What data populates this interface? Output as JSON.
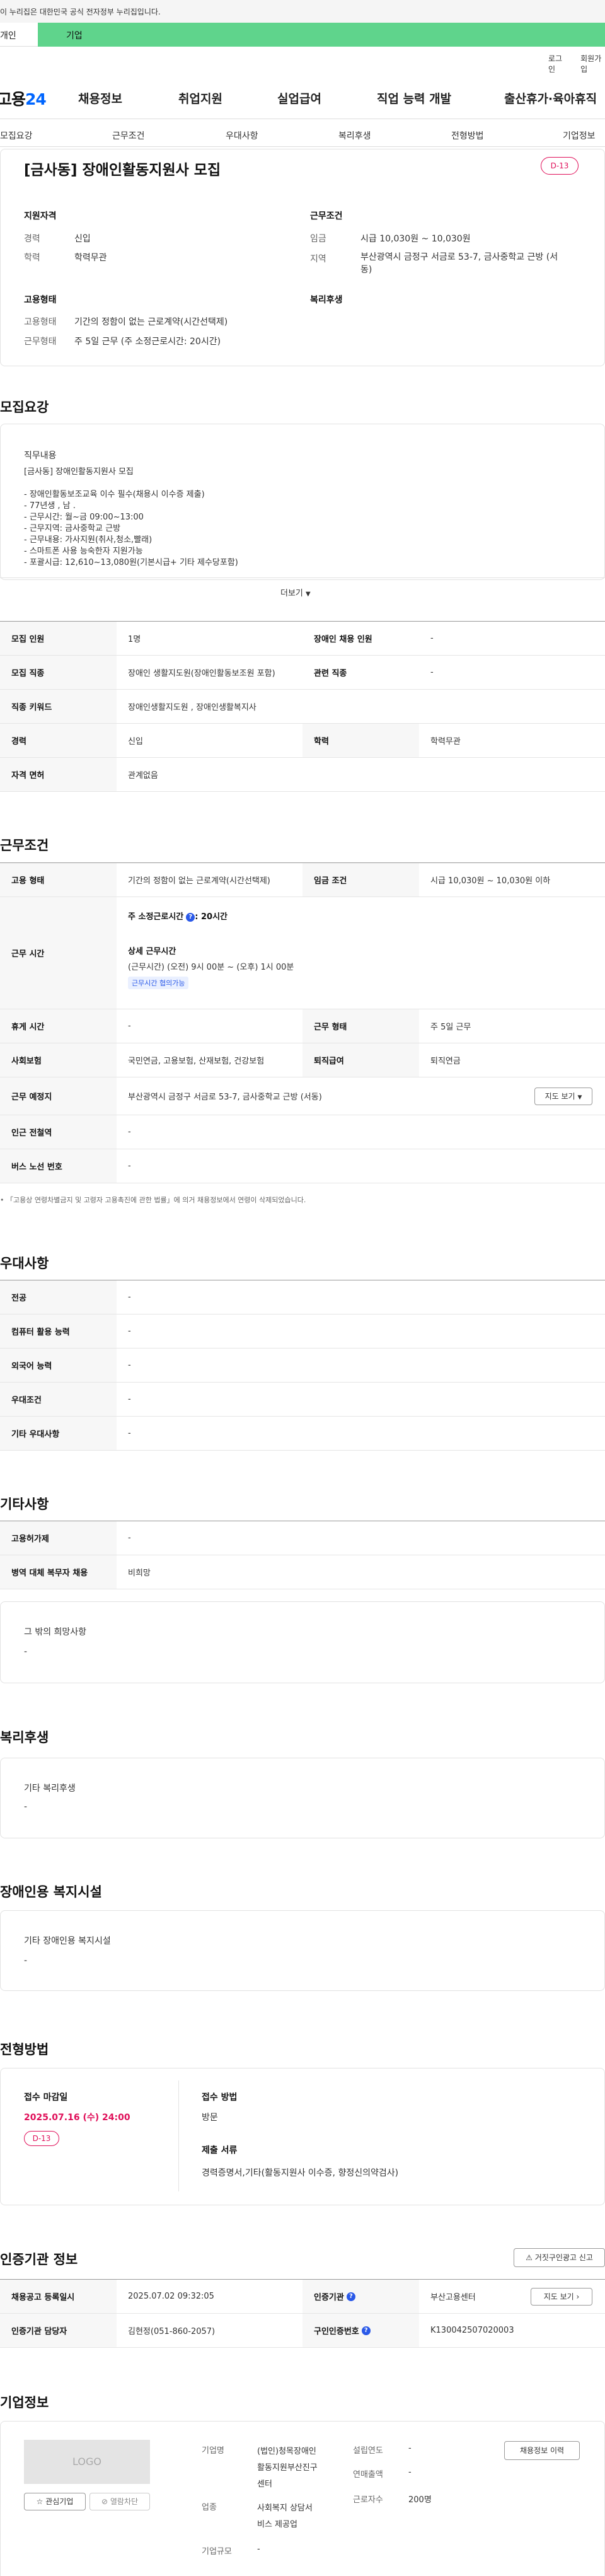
{
  "gov_banner": "이 누리집은 대한민국 공식 전자정부 누리집입니다.",
  "user_type_tabs": {
    "personal": "개인",
    "company": "기업"
  },
  "util_links": [
    "로그인",
    "회원가입"
  ],
  "brand": {
    "prefix": "고용",
    "num": "24"
  },
  "gnb": [
    "채용정보",
    "취업지원",
    "실업급여",
    "직업 능력 개발",
    "출산휴가·육아휴직"
  ],
  "anchor_nav": [
    "모집요강",
    "근무조건",
    "우대사항",
    "복리후생",
    "전형방법",
    "기업정보"
  ],
  "summary": {
    "title": "[금사동] 장애인활동지원사 모집",
    "dday": "D-13",
    "qual": {
      "heading": "지원자격",
      "career_label": "경력",
      "career": "신입",
      "edu_label": "학력",
      "edu": "학력무관"
    },
    "cond": {
      "heading": "근무조건",
      "wage_label": "임금",
      "wage": "시급 10,030원 ~ 10,030원",
      "region_label": "지역",
      "region_line1": "부산광역시 금정구 서금로 53-7, 금사중학교 근방 (서",
      "region_line2": "동)"
    },
    "emp": {
      "heading": "고용형태",
      "type_label": "고용형태",
      "type": "기간의 정함이 없는 근로계약(시간선택제)",
      "work_label": "근무형태",
      "work": "주 5일 근무 (주 소정근로시간: 20시간)"
    },
    "welfare_heading": "복리후생"
  },
  "recruit": {
    "title": "모집요강",
    "duty_heading": "직무내용",
    "duty_lines": [
      "[금사동] 장애인활동지원사 모집",
      "",
      "- 장애인활동보조교육 이수 필수(채용시 이수증 제출)",
      "- 77년생 , 남 .",
      "- 근무시간: 월~금 09:00~13:00",
      "- 근무지역: 금사중학교 근방",
      "- 근무내용: 가사지원(취사,청소,빨래)",
      "- 스마트폰 사용 능숙한자 지원가능",
      "- 포괄시급: 12,610~13,080원(기본시급+ 기타 제수당포함)"
    ],
    "more_label": "더보기",
    "rows": [
      {
        "l1": "모집 인원",
        "v1": "1명",
        "l2": "장애인 채용 인원",
        "v2": "-"
      },
      {
        "l1": "모집 직종",
        "v1": "장애인 생활지도원(장애인활동보조원 포함)",
        "l2": "관련 직종",
        "v2": "-"
      },
      {
        "l1": "직종 키워드",
        "v1": "장애인생활지도원 , 장애인생활복지사"
      },
      {
        "l1": "경력",
        "v1": "신입",
        "l2": "학력",
        "v2": "학력무관"
      },
      {
        "l1": "자격 면허",
        "v1": "관계없음"
      }
    ]
  },
  "workcond": {
    "title": "근무조건",
    "type_label": "고용 형태",
    "type": "기간의 정함이 없는 근로계약(시간선택제)",
    "wage_label": "임금 조건",
    "wage": "시급 10,030원 ~ 10,030원 이하",
    "time_label": "근무 시간",
    "weekly_label": "주 소정근로시간",
    "weekly_value": ": 20시간",
    "detail_label": "상세 근무시간",
    "detail": "(근무시간) (오전) 9시 00분 ~ (오후) 1시 00분",
    "negotiable": "근무시간 협의가능",
    "rest_label": "휴게 시간",
    "rest": "-",
    "form_label": "근무 형태",
    "form": "주 5일 근무",
    "ins_label": "사회보험",
    "ins": "국민연금, 고용보험, 산재보험, 건강보험",
    "sev_label": "퇴직급여",
    "sev": "퇴직연금",
    "place_label": "근무 예정지",
    "place": "부산광역시 금정구 서금로 53-7, 금사중학교 근방 (서동)",
    "map_label": "지도 보기",
    "station_label": "인근 전철역",
    "station": "-",
    "bus_label": "버스 노선 번호",
    "bus": "-",
    "notice": "「고용상 연령차별금지 및 고령자 고용촉진에 관한 법률」에 의거 채용정보에서 연령이 삭제되었습니다."
  },
  "pref": {
    "title": "우대사항",
    "rows": [
      {
        "l": "전공",
        "v": "-"
      },
      {
        "l": "컴퓨터 활용 능력",
        "v": "-"
      },
      {
        "l": "외국어 능력",
        "v": "-"
      },
      {
        "l": "우대조건",
        "v": "-"
      },
      {
        "l": "기타 우대사항",
        "v": "-"
      }
    ]
  },
  "etc": {
    "title": "기타사항",
    "rows": [
      {
        "l": "고용허가제",
        "v": "-"
      },
      {
        "l": "병역 대체 복무자 채용",
        "v": "비희망"
      }
    ],
    "box_heading": "그 밖의 희망사항",
    "box_value": "-"
  },
  "welfare": {
    "title": "복리후생",
    "heading": "기타 복리후생",
    "value": "-"
  },
  "facility": {
    "title": "장애인용 복지시설",
    "heading": "기타 장애인용 복지시설",
    "value": "-"
  },
  "screening": {
    "title": "전형방법",
    "deadline_label": "접수 마감일",
    "deadline": "2025.07.16 (수) 24:00",
    "dday": "D-13",
    "method_label": "접수 방법",
    "method": "방문",
    "docs_label": "제출 서류",
    "docs": "경력증명서,기타(활동지원사 이수증, 향정신의약검사)"
  },
  "cert": {
    "title": "인증기관 정보",
    "report_label": "거짓구인광고 신고",
    "reg_label": "채용공고 등록일시",
    "reg": "2025.07.02 09:32:05",
    "org_label": "인증기관",
    "org": "부산고용센터",
    "map_label": "지도 보기",
    "mgr_label": "인증기관 담당자",
    "mgr": "김현정(051-860-2057)",
    "no_label": "구인인증번호",
    "no": "K130042507020003"
  },
  "company": {
    "title": "기업정보",
    "logo": "LOGO",
    "fav_label": "관심기업",
    "block_label": "열람차단",
    "history_label": "채용정보 이력",
    "name_label": "기업명",
    "name_lines": [
      "(법인)청목장애인",
      "활동지원부산진구",
      "센터"
    ],
    "found_label": "설립연도",
    "found": "-",
    "sales_label": "연매출액",
    "sales": "-",
    "ind_label": "업종",
    "ind_lines": [
      "사회복지 상담서",
      "비스 제공업"
    ],
    "emp_label": "근로자수",
    "emp": "200명",
    "size_label": "기업규모",
    "size": "-"
  }
}
